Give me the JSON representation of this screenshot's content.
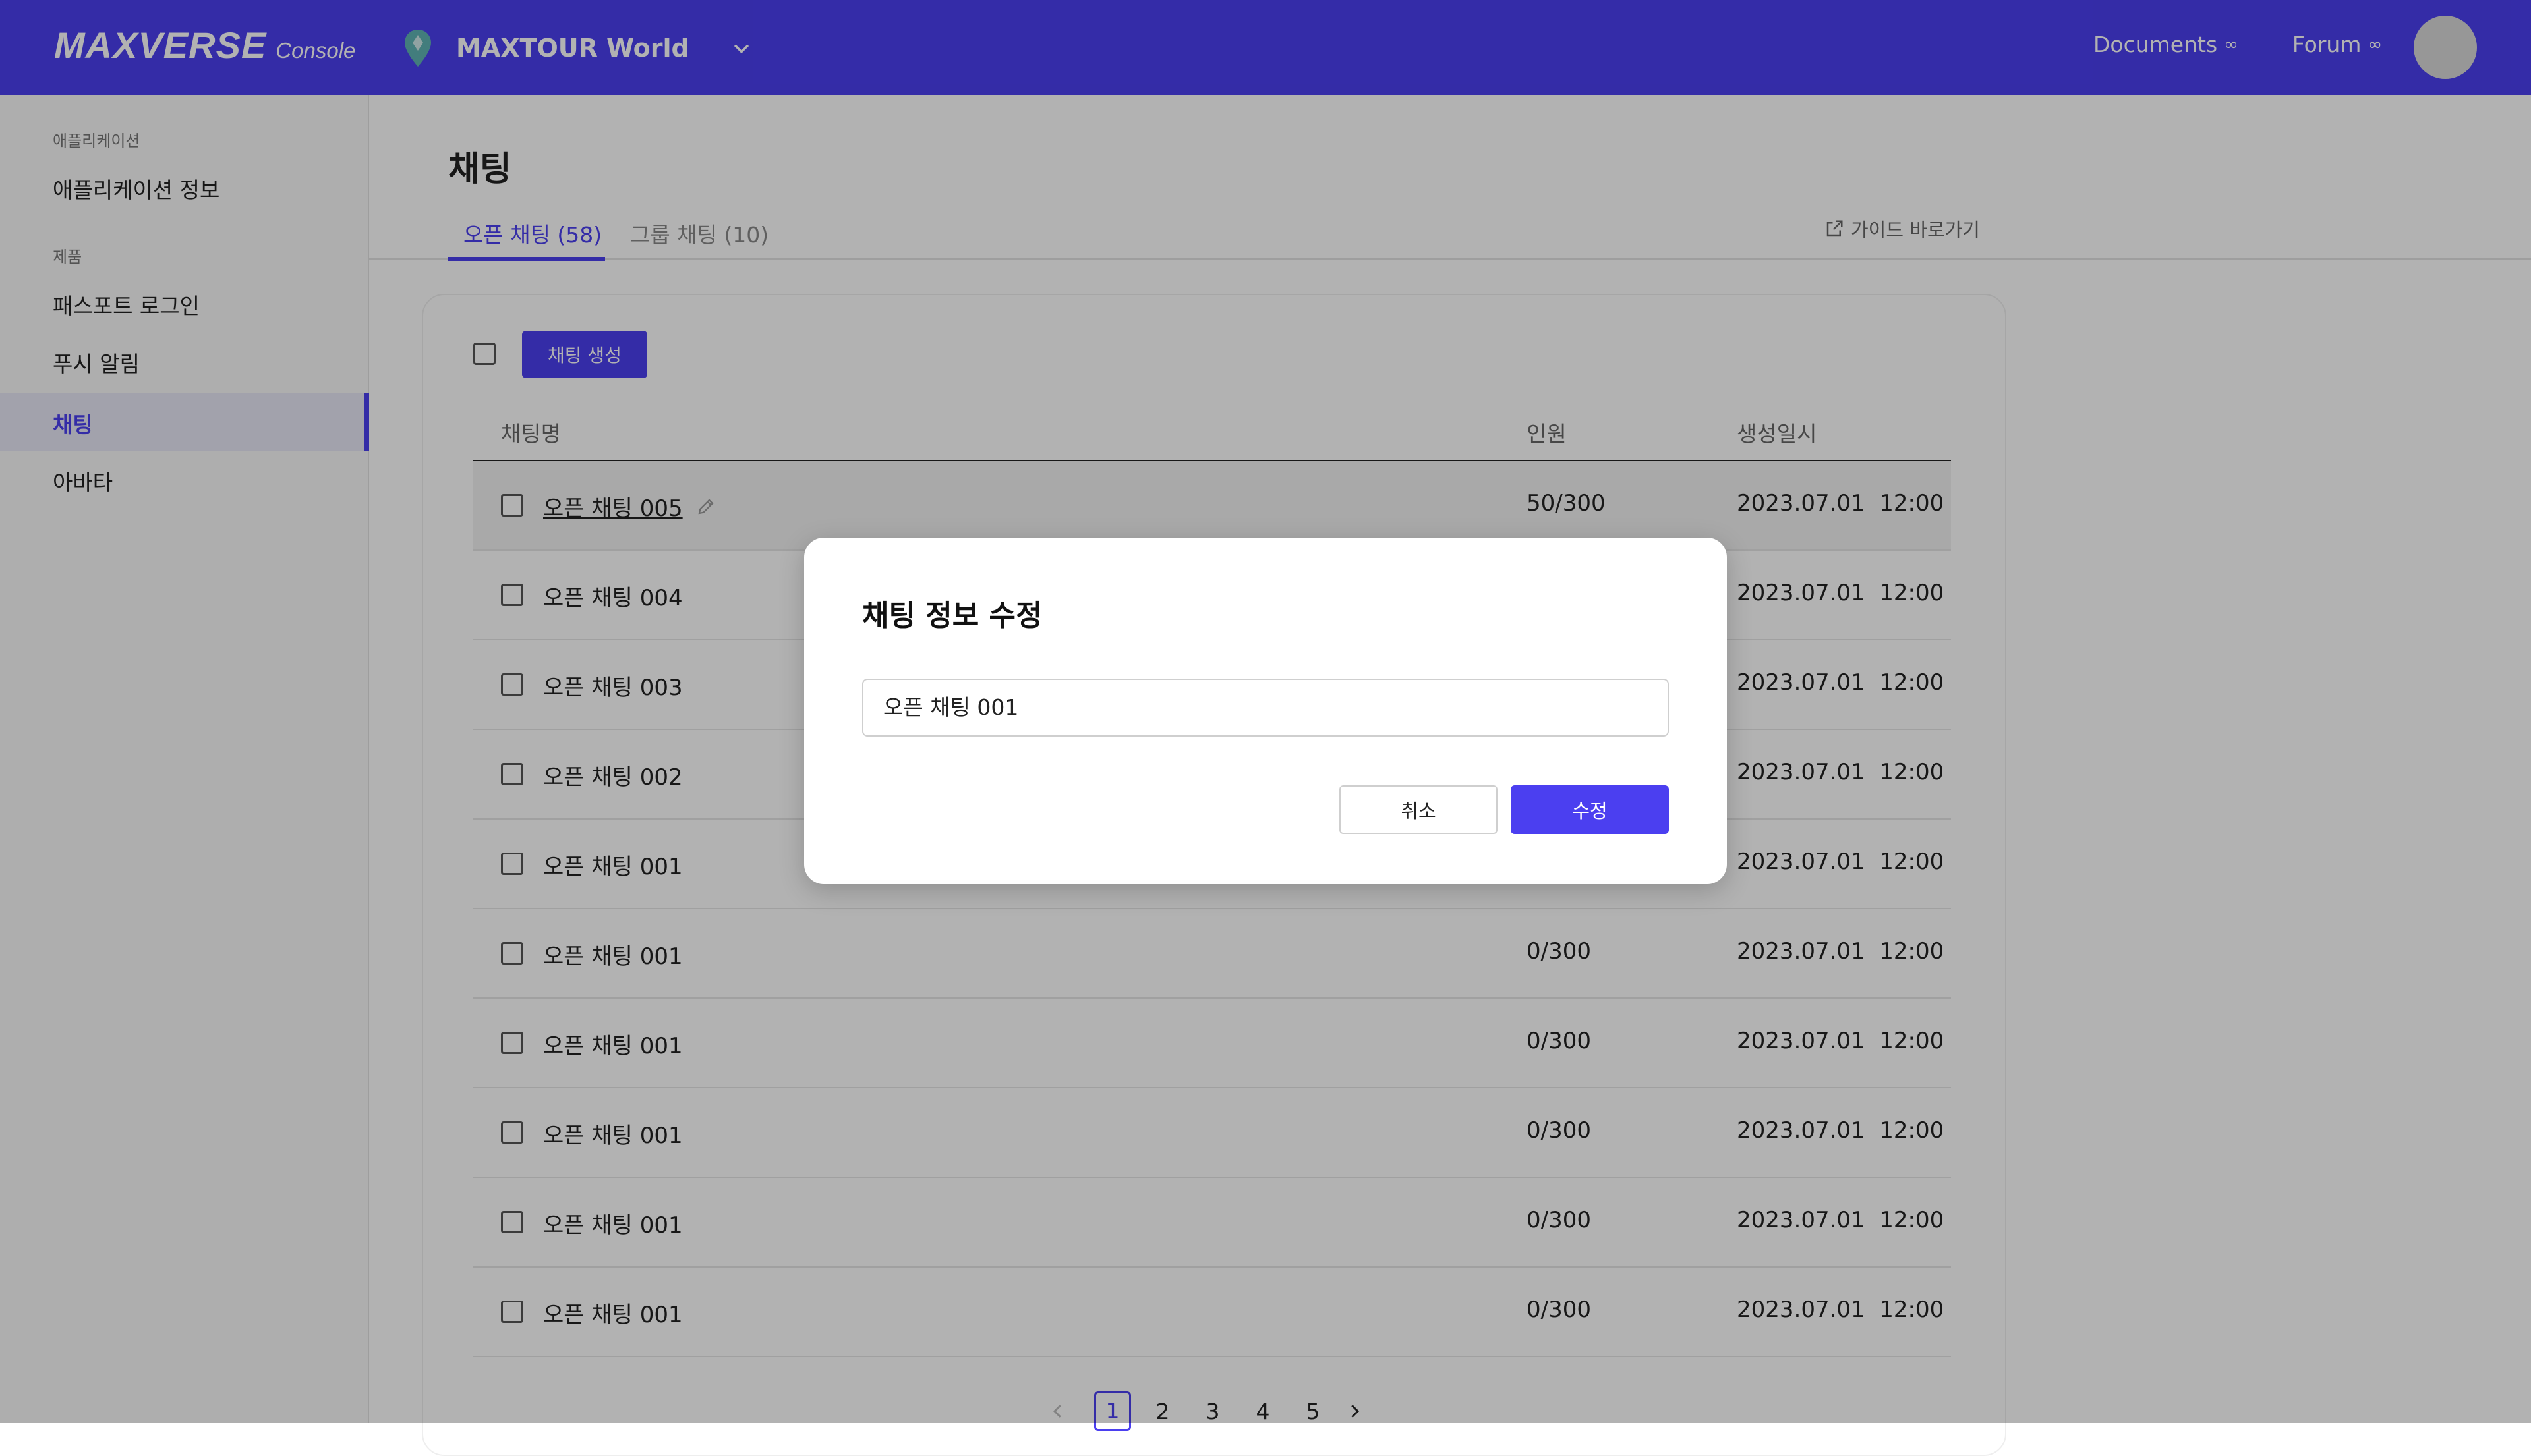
{
  "header": {
    "logo_main": "MAXVERSE",
    "logo_sub": "Console",
    "app_name": "MAXTOUR World",
    "nav": [
      {
        "label": "Documents",
        "ext": "∞"
      },
      {
        "label": "Forum",
        "ext": "∞"
      }
    ]
  },
  "sidebar": {
    "sections": [
      {
        "label": "애플리케이션"
      },
      {
        "label": "제품"
      }
    ],
    "items": [
      {
        "label": "애플리케이션 정보"
      },
      {
        "label": "패스포트 로그인"
      },
      {
        "label": "푸시 알림"
      },
      {
        "label": "채팅",
        "active": true
      },
      {
        "label": "아바타"
      }
    ]
  },
  "main": {
    "title": "채팅",
    "tabs": [
      {
        "label": "오픈 채팅 (58)",
        "active": true
      },
      {
        "label": "그룹 채팅 (10)"
      }
    ],
    "guide_label": "가이드 바로가기",
    "create_button": "채팅 생성",
    "columns": {
      "name": "채팅명",
      "members": "인원",
      "created": "생성일시"
    },
    "rows": [
      {
        "name": "오픈 채팅 005",
        "members": "50/300",
        "created": "2023.07.01  12:00"
      },
      {
        "name": "오픈 채팅 004",
        "members": "",
        "created": "2023.07.01  12:00"
      },
      {
        "name": "오픈 채팅 003",
        "members": "",
        "created": "2023.07.01  12:00"
      },
      {
        "name": "오픈 채팅 002",
        "members": "",
        "created": "2023.07.01  12:00"
      },
      {
        "name": "오픈 채팅 001",
        "members": "",
        "created": "2023.07.01  12:00"
      },
      {
        "name": "오픈 채팅 001",
        "members": "0/300",
        "created": "2023.07.01  12:00"
      },
      {
        "name": "오픈 채팅 001",
        "members": "0/300",
        "created": "2023.07.01  12:00"
      },
      {
        "name": "오픈 채팅 001",
        "members": "0/300",
        "created": "2023.07.01  12:00"
      },
      {
        "name": "오픈 채팅 001",
        "members": "0/300",
        "created": "2023.07.01  12:00"
      },
      {
        "name": "오픈 채팅 001",
        "members": "0/300",
        "created": "2023.07.01  12:00"
      }
    ],
    "pagination": {
      "pages": [
        "1",
        "2",
        "3",
        "4",
        "5"
      ],
      "current": "1"
    }
  },
  "modal": {
    "title": "채팅 정보 수정",
    "input_value": "오픈 채팅 001",
    "cancel_label": "취소",
    "confirm_label": "수정"
  },
  "colors": {
    "accent": "#4b3ff0",
    "header_bg": "#4b3ff0"
  }
}
